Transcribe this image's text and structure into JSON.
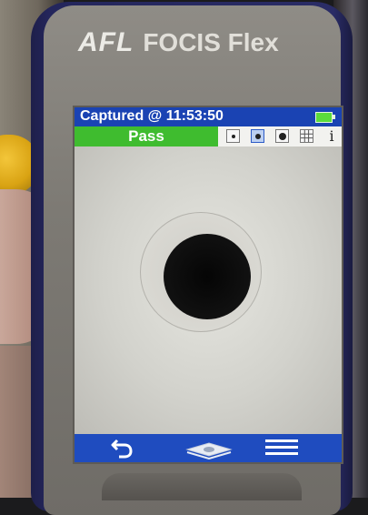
{
  "device": {
    "brand": "AFL",
    "model": "FOCIS Flex"
  },
  "screen": {
    "title": "Captured @ 11:53:50",
    "result": "Pass",
    "battery": {
      "level": 1.0,
      "color": "#5bdc3c"
    },
    "view_tools": [
      {
        "name": "view-small-icon",
        "active": false
      },
      {
        "name": "view-medium-icon",
        "active": true
      },
      {
        "name": "view-large-icon",
        "active": false
      },
      {
        "name": "grid-icon",
        "active": false
      },
      {
        "name": "info-icon",
        "active": false
      }
    ],
    "info_symbol": "i",
    "toolbar": [
      {
        "name": "back-arrow-icon"
      },
      {
        "name": "capture-stack-icon"
      },
      {
        "name": "menu-icon"
      }
    ]
  },
  "colors": {
    "title_bar": "#1a43b3",
    "pass_green": "#3fbc2f",
    "toolbar_blue": "#1f4cbf"
  }
}
